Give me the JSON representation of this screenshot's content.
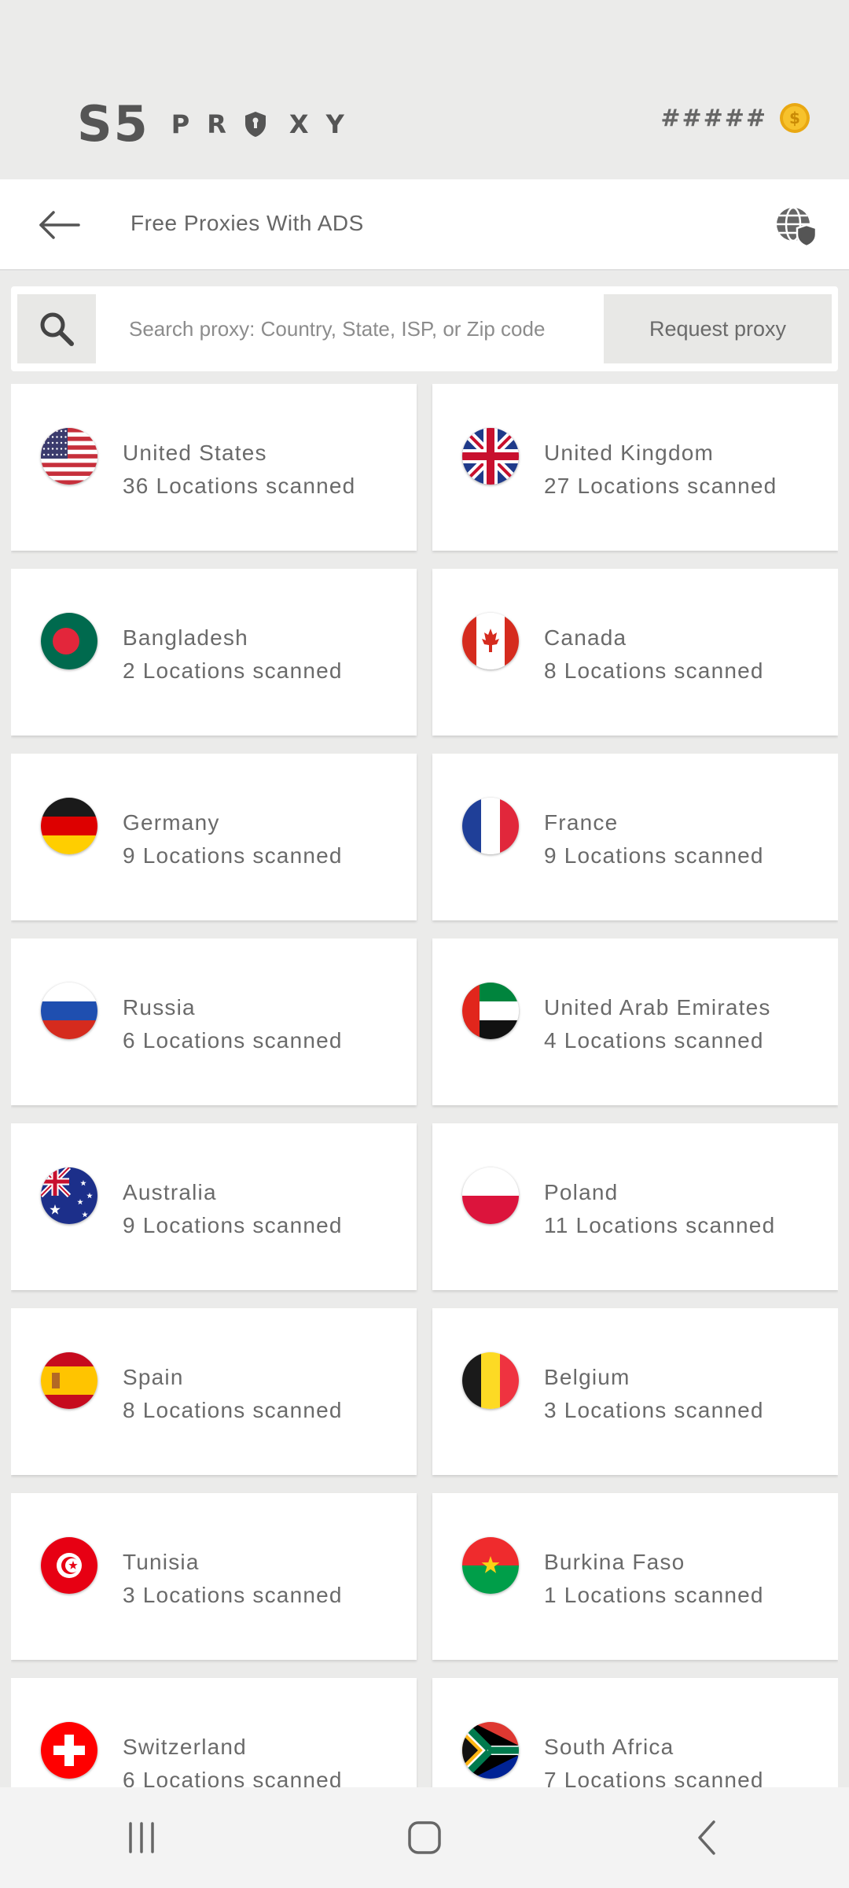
{
  "brand": {
    "logo_mark": "S5",
    "logo_word": [
      "P",
      "R",
      "X",
      "Y"
    ],
    "coins": "#####",
    "coin_icon": "gold-coin-icon"
  },
  "toolbar": {
    "title": "Free Proxies With ADS",
    "back_icon": "arrow-left-icon",
    "globe_icon": "globe-shield-icon"
  },
  "search": {
    "placeholder": "Search proxy: Country, State, ISP, or Zip code",
    "value": "",
    "request_label": "Request proxy"
  },
  "countries": [
    {
      "name": "United States",
      "count": "36 Locations scanned",
      "flag": "us"
    },
    {
      "name": "United Kingdom",
      "count": "27 Locations scanned",
      "flag": "gb"
    },
    {
      "name": "Bangladesh",
      "count": "2 Locations scanned",
      "flag": "bd"
    },
    {
      "name": "Canada",
      "count": "8 Locations scanned",
      "flag": "ca"
    },
    {
      "name": "Germany",
      "count": "9 Locations scanned",
      "flag": "de"
    },
    {
      "name": "France",
      "count": "9 Locations scanned",
      "flag": "fr"
    },
    {
      "name": "Russia",
      "count": "6 Locations scanned",
      "flag": "ru"
    },
    {
      "name": "United Arab Emirates",
      "count": "4 Locations scanned",
      "flag": "ae"
    },
    {
      "name": "Australia",
      "count": "9 Locations scanned",
      "flag": "au"
    },
    {
      "name": "Poland",
      "count": "11 Locations scanned",
      "flag": "pl"
    },
    {
      "name": "Spain",
      "count": "8 Locations scanned",
      "flag": "es"
    },
    {
      "name": "Belgium",
      "count": "3 Locations scanned",
      "flag": "be"
    },
    {
      "name": "Tunisia",
      "count": "3 Locations scanned",
      "flag": "tn"
    },
    {
      "name": "Burkina Faso",
      "count": "1 Locations scanned",
      "flag": "bf"
    },
    {
      "name": "Switzerland",
      "count": "6 Locations scanned",
      "flag": "ch"
    },
    {
      "name": "South Africa",
      "count": "7 Locations scanned",
      "flag": "za"
    }
  ],
  "navbar": {
    "recents_icon": "recent-apps-icon",
    "home_icon": "home-icon",
    "back_icon": "nav-back-icon"
  }
}
